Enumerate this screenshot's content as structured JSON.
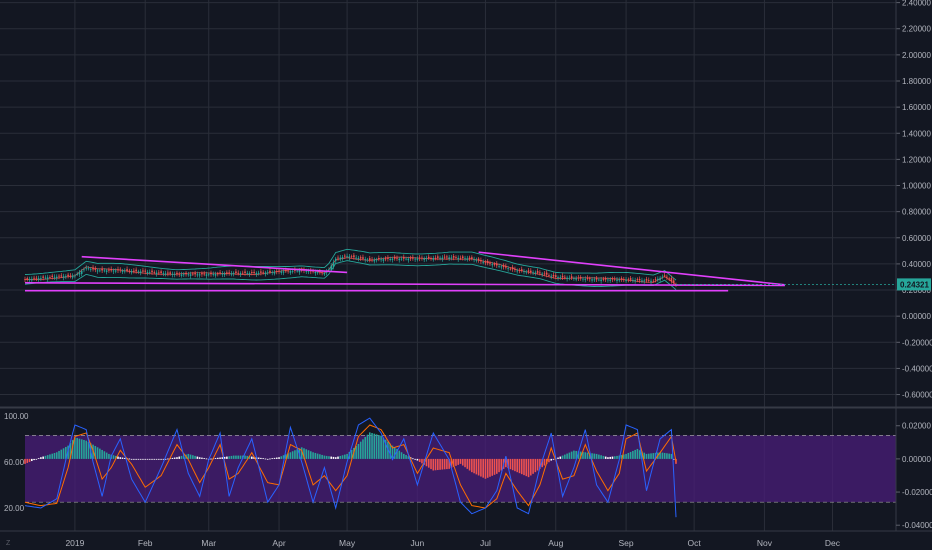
{
  "colors": {
    "background": "#131722",
    "grid": "#2a2e39",
    "axis_text": "#b2b5be",
    "trendline": "#e040fb",
    "bollinger": "#26a69a",
    "candle_up": "#26a69a",
    "candle_down": "#ef5350",
    "stoch_k": "#2962ff",
    "stoch_d": "#ff6d00",
    "stoch_band": "#4a1e7a",
    "macd_hist_up": "#26a69a",
    "macd_hist_down": "#ef5350",
    "macd_hist_zero": "#ffffff",
    "price_badge": "#26a69a"
  },
  "corner_label": "Z",
  "chart_data": [
    {
      "type": "candlestick",
      "title": "",
      "y_axis_labels": [
        "2.40000",
        "2.20000",
        "2.00000",
        "1.80000",
        "1.60000",
        "1.40000",
        "1.20000",
        "1.00000",
        "0.80000",
        "0.60000",
        "0.40000",
        "0.20000",
        "0.00000",
        "-0.20000",
        "-0.40000",
        "-0.60000"
      ],
      "ylim": [
        -0.68,
        2.42
      ],
      "last_price_label": "0.24321",
      "last_price": 0.24321,
      "x_tick_labels": [
        "2019",
        "Feb",
        "Mar",
        "Apr",
        "May",
        "Jun",
        "Jul",
        "Aug",
        "Sep",
        "Oct",
        "Nov",
        "Dec"
      ],
      "x_tick_days": [
        0,
        31,
        59,
        90,
        120,
        151,
        181,
        212,
        243,
        273,
        304,
        334
      ],
      "xlim_days": [
        -22,
        362
      ],
      "last_day": 265,
      "close_series": {
        "days": [
          -22,
          -10,
          0,
          5,
          10,
          20,
          31,
          45,
          59,
          70,
          80,
          90,
          100,
          110,
          112,
          115,
          120,
          130,
          140,
          151,
          165,
          175,
          181,
          195,
          205,
          212,
          230,
          243,
          255,
          260,
          265
        ],
        "values": [
          0.28,
          0.3,
          0.31,
          0.37,
          0.35,
          0.35,
          0.34,
          0.32,
          0.32,
          0.33,
          0.33,
          0.34,
          0.35,
          0.33,
          0.36,
          0.44,
          0.46,
          0.43,
          0.44,
          0.44,
          0.45,
          0.44,
          0.41,
          0.35,
          0.33,
          0.3,
          0.28,
          0.28,
          0.27,
          0.31,
          0.24
        ]
      },
      "trendlines": [
        {
          "days": [
            3,
            120
          ],
          "values": [
            0.455,
            0.335
          ]
        },
        {
          "days": [
            178,
            313
          ],
          "values": [
            0.49,
            0.24
          ]
        },
        {
          "days": [
            -22,
            313
          ],
          "values": [
            0.255,
            0.235
          ]
        },
        {
          "days": [
            -22,
            288
          ],
          "values": [
            0.195,
            0.195
          ]
        }
      ]
    },
    {
      "type": "line",
      "title": "",
      "left_axis_labels": [
        "100.00",
        "60.00",
        "20.00"
      ],
      "left_axis_values": [
        100,
        60,
        20
      ],
      "left_ylim": [
        0,
        105
      ],
      "band": [
        25,
        83
      ],
      "right_axis_labels": [
        "0.02000",
        "0.00000",
        "-0.02000",
        "-0.04000"
      ],
      "right_axis_values": [
        0.02,
        0,
        -0.02,
        -0.04
      ],
      "right_ylim": [
        -0.0435,
        0.0295
      ],
      "series": [
        {
          "axis": "left",
          "days": [
            -22,
            -15,
            -8,
            -3,
            0,
            5,
            8,
            12,
            16,
            20,
            25,
            31,
            38,
            45,
            50,
            55,
            59,
            64,
            68,
            72,
            78,
            85,
            90,
            95,
            100,
            105,
            110,
            115,
            120,
            125,
            130,
            135,
            140,
            145,
            151,
            158,
            165,
            170,
            175,
            181,
            186,
            190,
            195,
            200,
            205,
            210,
            215,
            220,
            225,
            230,
            235,
            240,
            243,
            248,
            252,
            258,
            263,
            265
          ],
          "values": [
            22,
            20,
            28,
            70,
            92,
            88,
            60,
            30,
            65,
            80,
            45,
            25,
            55,
            88,
            50,
            30,
            62,
            85,
            30,
            55,
            80,
            25,
            40,
            90,
            60,
            25,
            55,
            20,
            60,
            92,
            98,
            85,
            62,
            80,
            40,
            85,
            62,
            25,
            15,
            20,
            35,
            65,
            20,
            15,
            55,
            85,
            30,
            55,
            88,
            40,
            25,
            62,
            92,
            88,
            35,
            80,
            88,
            12
          ]
        },
        {
          "axis": "left",
          "days": [
            -22,
            -15,
            -8,
            -3,
            0,
            5,
            8,
            12,
            16,
            20,
            25,
            31,
            38,
            45,
            50,
            55,
            59,
            64,
            68,
            72,
            78,
            85,
            90,
            95,
            100,
            105,
            110,
            115,
            120,
            125,
            130,
            135,
            140,
            145,
            151,
            158,
            165,
            170,
            175,
            181,
            186,
            190,
            195,
            200,
            205,
            210,
            215,
            220,
            225,
            230,
            235,
            240,
            243,
            248,
            252,
            258,
            263,
            265
          ],
          "values": [
            25,
            22,
            24,
            55,
            82,
            85,
            70,
            45,
            55,
            70,
            58,
            38,
            48,
            75,
            62,
            42,
            55,
            75,
            45,
            50,
            68,
            42,
            40,
            75,
            70,
            40,
            48,
            35,
            48,
            82,
            92,
            88,
            72,
            75,
            50,
            72,
            68,
            40,
            22,
            20,
            28,
            50,
            35,
            22,
            40,
            72,
            45,
            48,
            75,
            52,
            35,
            50,
            80,
            85,
            52,
            68,
            82,
            60
          ]
        },
        {
          "axis": "right",
          "type": "histogram",
          "days": [
            -22,
            -15,
            -8,
            -3,
            0,
            5,
            10,
            15,
            20,
            25,
            31,
            40,
            45,
            50,
            55,
            59,
            65,
            70,
            75,
            80,
            85,
            90,
            95,
            100,
            105,
            110,
            115,
            120,
            125,
            130,
            135,
            140,
            145,
            151,
            158,
            165,
            170,
            175,
            181,
            186,
            190,
            195,
            200,
            205,
            210,
            215,
            220,
            225,
            230,
            235,
            240,
            243,
            248,
            252,
            258,
            263,
            265
          ],
          "values": [
            -0.003,
            0.001,
            0.004,
            0.008,
            0.013,
            0.011,
            0.007,
            0.003,
            0.001,
            0.0,
            0.0,
            0.0,
            0.001,
            0.003,
            0.001,
            0.0,
            0.001,
            0.002,
            0.002,
            0.001,
            0.0,
            0.001,
            0.004,
            0.007,
            0.004,
            0.002,
            0.001,
            0.003,
            0.009,
            0.016,
            0.014,
            0.008,
            0.003,
            -0.001,
            -0.007,
            -0.006,
            -0.003,
            -0.008,
            -0.012,
            -0.009,
            -0.005,
            -0.008,
            -0.011,
            -0.006,
            -0.001,
            0.002,
            0.005,
            0.004,
            0.003,
            0.001,
            0.002,
            0.003,
            0.006,
            0.003,
            0.004,
            0.003,
            -0.003
          ]
        }
      ]
    }
  ]
}
